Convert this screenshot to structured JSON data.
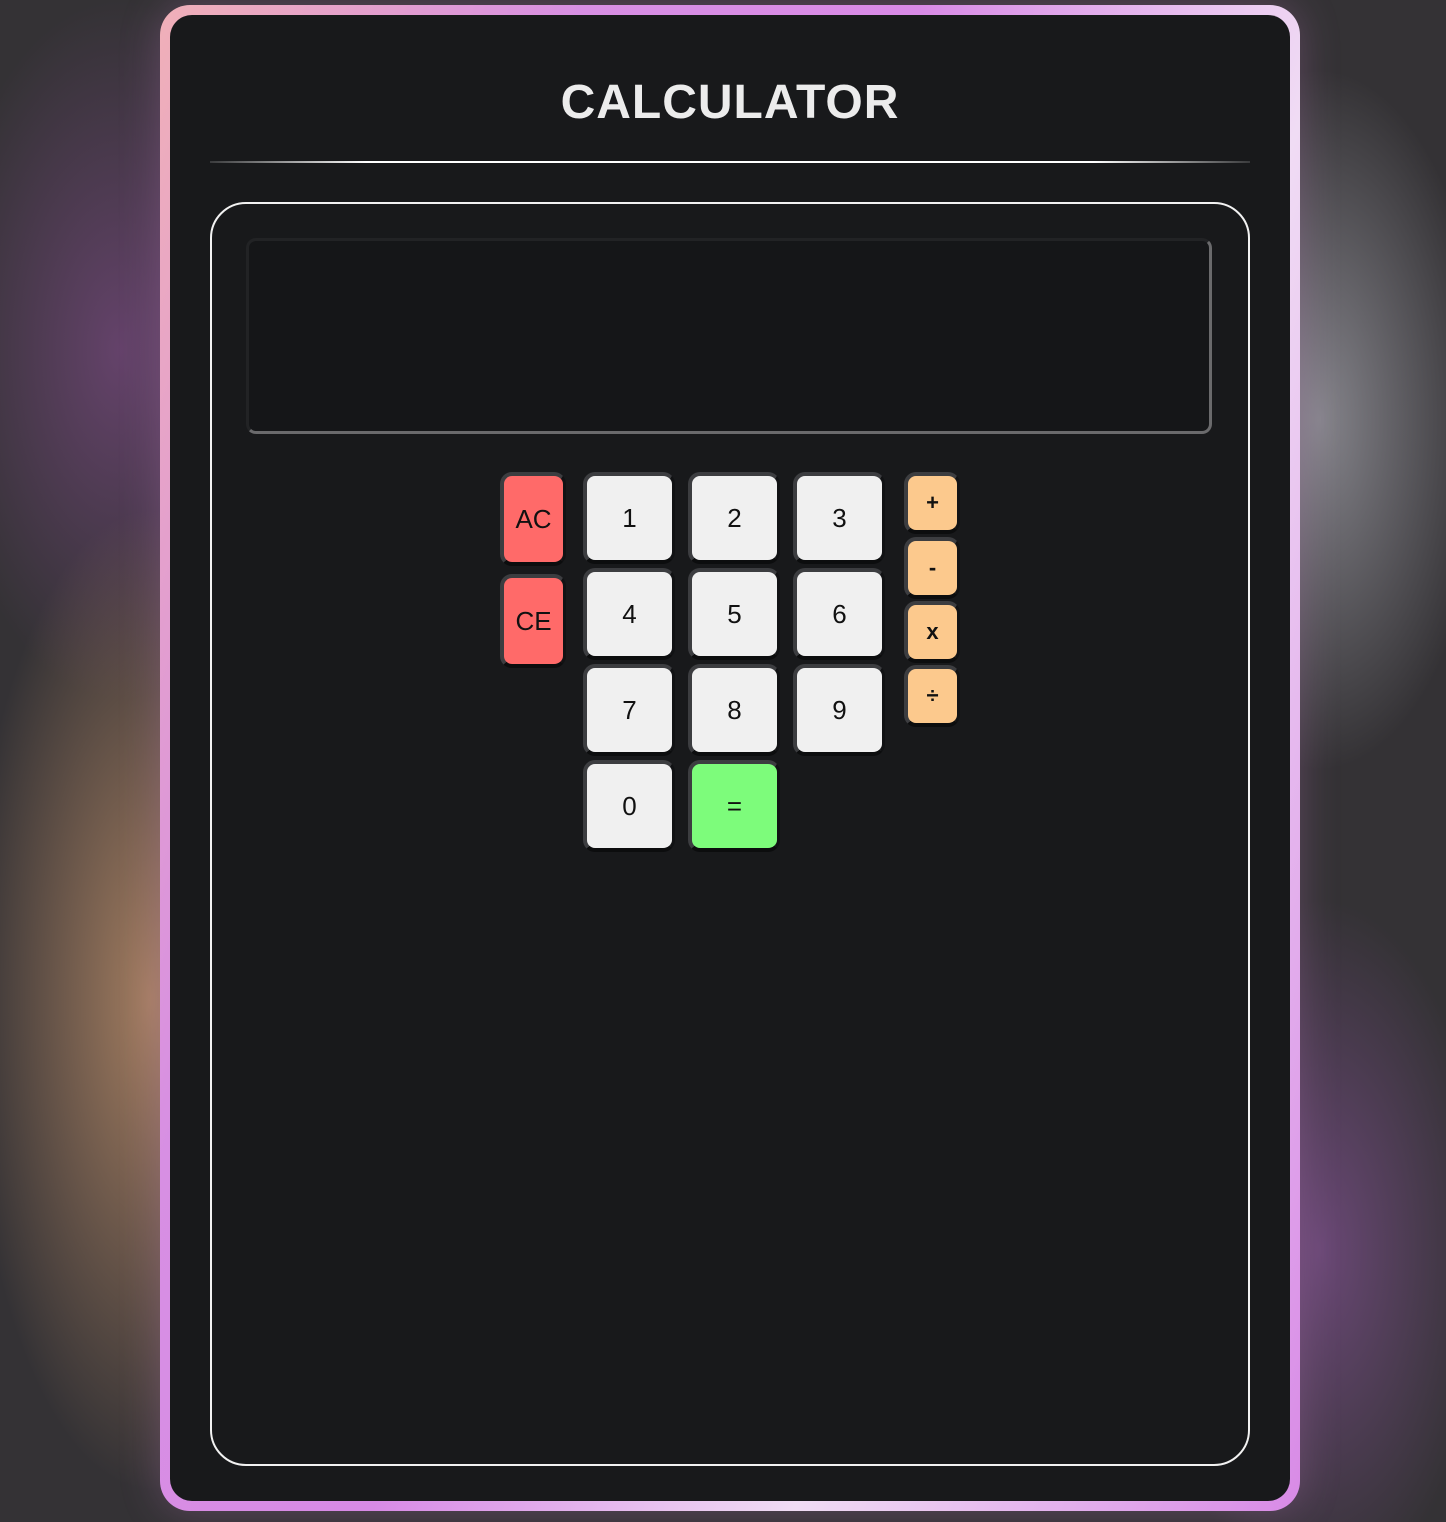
{
  "title": "CALCULATOR",
  "display": {
    "value": ""
  },
  "keys": {
    "ac": "AC",
    "ce": "CE",
    "digits": [
      "1",
      "2",
      "3",
      "4",
      "5",
      "6",
      "7",
      "8",
      "9",
      "0"
    ],
    "equals": "=",
    "plus": "+",
    "minus": "-",
    "times": "x",
    "divide": "÷"
  },
  "colors": {
    "clear_keys": "#ff6a69",
    "digit_keys": "#f0f0f0",
    "operator_keys": "#fcc98d",
    "equals_key": "#7dfc7b",
    "card_background": "#18191b"
  }
}
